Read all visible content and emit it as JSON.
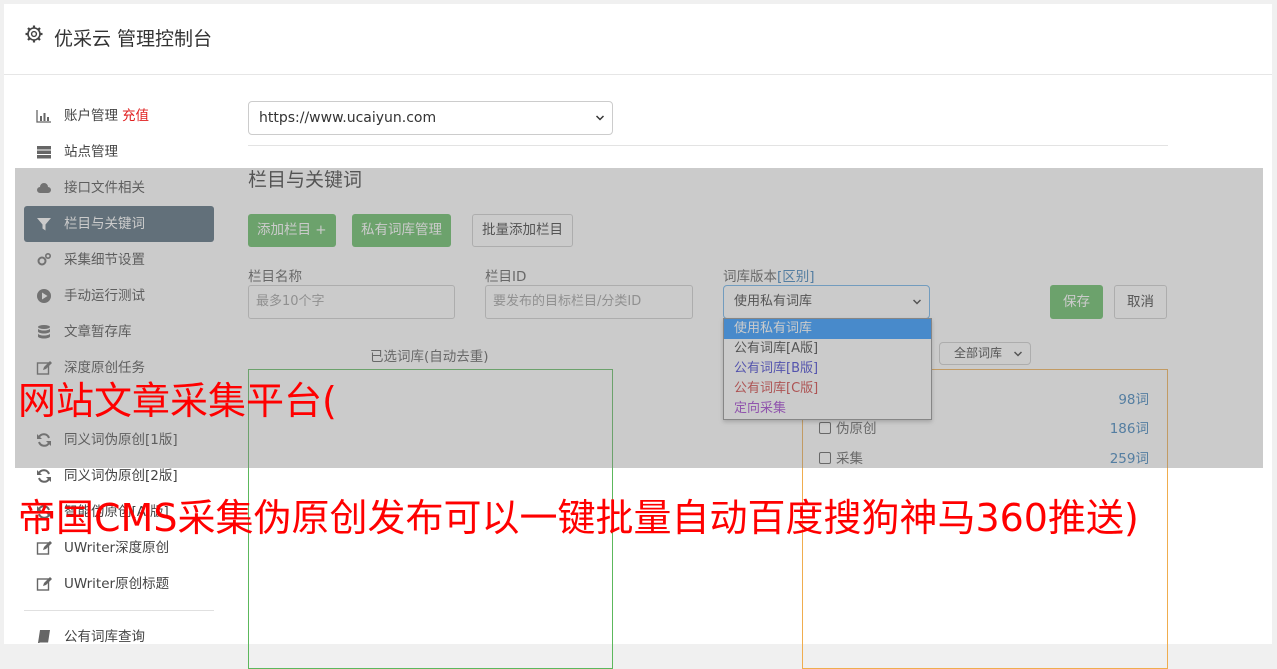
{
  "header": {
    "title": "优采云 管理控制台"
  },
  "sidebar": {
    "items": [
      {
        "label": "账户管理",
        "badge": "充值",
        "icon": "bar-chart-icon"
      },
      {
        "label": "站点管理",
        "icon": "server-icon"
      },
      {
        "label": "接口文件相关",
        "icon": "cloud-upload-icon"
      },
      {
        "label": "栏目与关键词",
        "icon": "filter-icon",
        "active": true
      },
      {
        "label": "采集细节设置",
        "icon": "gears-icon"
      },
      {
        "label": "手动运行测试",
        "icon": "play-icon"
      },
      {
        "label": "文章暂存库",
        "icon": "database-icon"
      },
      {
        "label": "深度原创任务",
        "icon": "edit-icon"
      },
      {
        "label": "",
        "icon": ""
      },
      {
        "label": "同义词伪原创[1版]",
        "icon": "refresh-icon"
      },
      {
        "label": "同义词伪原创[2版]",
        "icon": "refresh-icon"
      },
      {
        "label": "智能伪原创[AI版]",
        "icon": "refresh-icon"
      },
      {
        "label": "UWriter深度原创",
        "icon": "edit-icon"
      },
      {
        "label": "UWriter原创标题",
        "icon": "edit-icon"
      },
      {
        "label": "公有词库查询",
        "icon": "book-icon"
      }
    ]
  },
  "main": {
    "site_select": "https://www.ucaiyun.com",
    "section_title": "栏目与关键词",
    "buttons": {
      "add_column": "添加栏目 +",
      "private_lib": "私有词库管理",
      "batch_add": "批量添加栏目",
      "save": "保存",
      "cancel": "取消"
    },
    "form": {
      "name_label": "栏目名称",
      "name_placeholder": "最多10个字",
      "id_label": "栏目ID",
      "id_placeholder": "要发布的目标栏目/分类ID",
      "lib_label": "词库版本",
      "lib_label_link": "[区别]",
      "lib_value": "使用私有词库"
    },
    "dropdown_options": [
      {
        "label": "使用私有词库",
        "color": "#ffffff"
      },
      {
        "label": "公有词库[A版]",
        "color": "#333333"
      },
      {
        "label": "公有词库[B版]",
        "color": "#3333cc"
      },
      {
        "label": "公有词库[C版]",
        "color": "#cc3333"
      },
      {
        "label": "定向采集",
        "color": "#9933cc"
      }
    ],
    "selected_title": "已选词库(自动去重)",
    "filter_select": "全部词库",
    "libs": [
      {
        "label": "",
        "count": "98词"
      },
      {
        "label": "伪原创",
        "count": "186词"
      },
      {
        "label": "采集",
        "count": "259词"
      }
    ]
  },
  "overlay": {
    "headline1": "网站文章采集平台(",
    "headline2": "帝国CMS采集伪原创发布可以一键批量自动百度搜狗神马360推送)"
  },
  "colors": {
    "green": "#5cb85c",
    "active_nav": "#4a6274",
    "link": "#337ab7",
    "red": "#ff0000"
  }
}
